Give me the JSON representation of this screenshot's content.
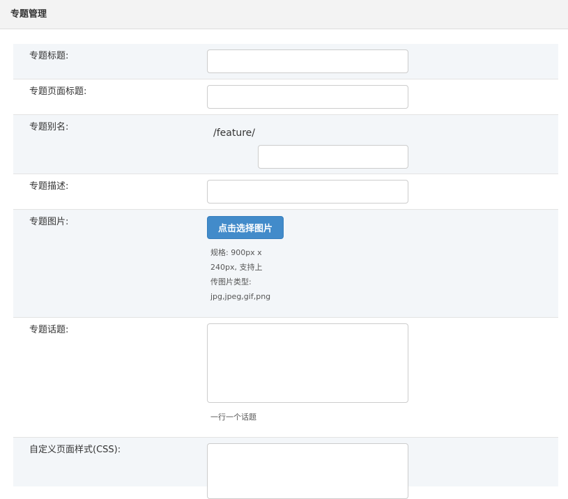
{
  "header": {
    "title": "专题管理"
  },
  "form": {
    "title": {
      "label": "专题标题:",
      "value": ""
    },
    "page_title": {
      "label": "专题页面标题:",
      "value": ""
    },
    "alias": {
      "label": "专题别名:",
      "prefix": "/feature/",
      "value": ""
    },
    "description": {
      "label": "专题描述:",
      "value": ""
    },
    "image": {
      "label": "专题图片:",
      "button_label": "点击选择图片",
      "help_lines": [
        "规格: 900px x",
        "240px, 支持上",
        "传图片类型:",
        "jpg,jpeg,gif,png"
      ]
    },
    "topics": {
      "label": "专题话题:",
      "value": "",
      "help": "一行一个话题"
    },
    "css": {
      "label": "自定义页面样式(CSS):",
      "value": ""
    }
  }
}
